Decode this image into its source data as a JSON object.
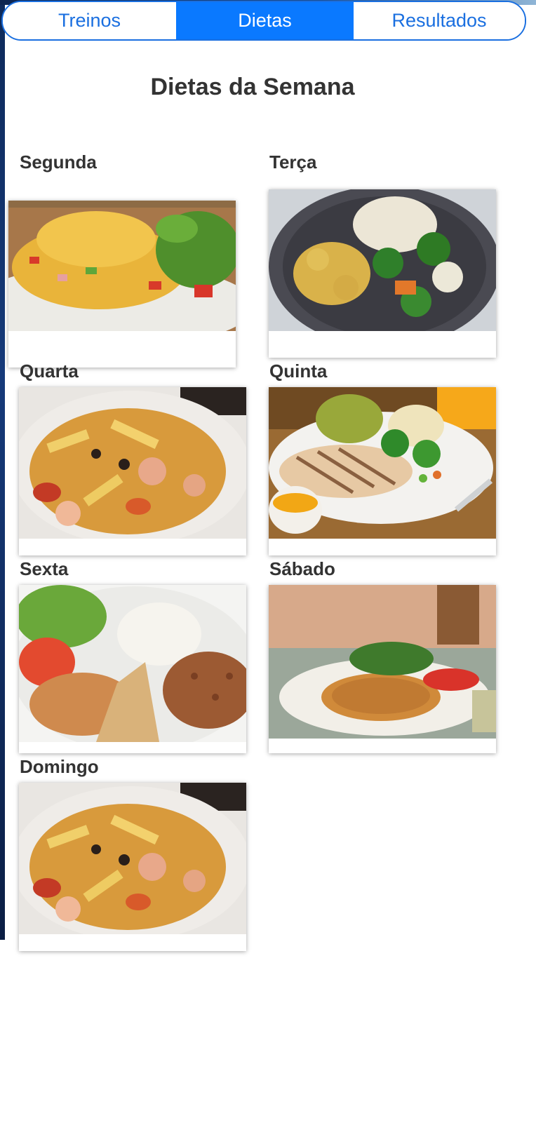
{
  "tabs": [
    {
      "label": "Treinos"
    },
    {
      "label": "Dietas"
    },
    {
      "label": "Resultados"
    }
  ],
  "page": {
    "title": "Dietas da Semana"
  },
  "days": [
    {
      "label": "Segunda",
      "photo": "omelette-salad-photo"
    },
    {
      "label": "Terça",
      "photo": "chicken-vegetables-bowl-photo"
    },
    {
      "label": "Quarta",
      "photo": "penne-pasta-photo"
    },
    {
      "label": "Quinta",
      "photo": "grilled-chicken-plate-photo"
    },
    {
      "label": "Sexta",
      "photo": "rice-beans-chicken-photo"
    },
    {
      "label": "Sábado",
      "photo": "omelette-greens-photo"
    },
    {
      "label": "Domingo",
      "photo": "penne-pasta-photo"
    }
  ],
  "colors": {
    "accent": "#0a79ff",
    "tab_text": "#1a6fe0"
  }
}
